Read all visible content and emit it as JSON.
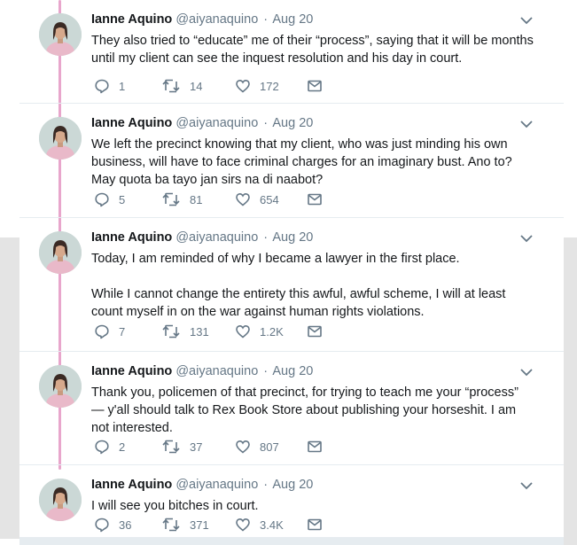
{
  "colors": {
    "thread_line": "#e8a6cc",
    "text": "#14171a",
    "secondary": "#657786",
    "background": "#e6ecf0"
  },
  "tweets": [
    {
      "name": "Ianne Aquino",
      "handle": "@aiyanaquino",
      "separator": "·",
      "date": "Aug 20",
      "text": "They also tried to “educate” me of their “process”, saying that it will be months until my client can see the inquest resolution and his day in court.",
      "replies": "1",
      "retweets": "14",
      "likes": "172"
    },
    {
      "name": "Ianne Aquino",
      "handle": "@aiyanaquino",
      "separator": "·",
      "date": "Aug 20",
      "text": "We left the precinct knowing that my client, who was just minding his own business, will have to face criminal charges for an imaginary bust. Ano to? May quota ba tayo jan sirs na di naabot?",
      "replies": "5",
      "retweets": "81",
      "likes": "654"
    },
    {
      "name": "Ianne Aquino",
      "handle": "@aiyanaquino",
      "separator": "·",
      "date": "Aug 20",
      "text": "Today, I am reminded of why I became a lawyer in the first place.\n\nWhile I cannot change the entirety this awful, awful scheme, I will at least count myself in on the war against human rights violations.",
      "replies": "7",
      "retweets": "131",
      "likes": "1.2K"
    },
    {
      "name": "Ianne Aquino",
      "handle": "@aiyanaquino",
      "separator": "·",
      "date": "Aug 20",
      "text": "Thank you, policemen of that precinct, for trying to teach me your “process” — y'all should talk to Rex Book Store about publishing your horseshit. I am not interested.",
      "replies": "2",
      "retweets": "37",
      "likes": "807"
    },
    {
      "name": "Ianne Aquino",
      "handle": "@aiyanaquino",
      "separator": "·",
      "date": "Aug 20",
      "text": "I will see you bitches in court.",
      "replies": "36",
      "retweets": "371",
      "likes": "3.4K"
    }
  ],
  "icons": {
    "reply": "reply-icon",
    "retweet": "retweet-icon",
    "like": "heart-icon",
    "message": "direct-message-icon",
    "caret": "chevron-down-icon"
  }
}
